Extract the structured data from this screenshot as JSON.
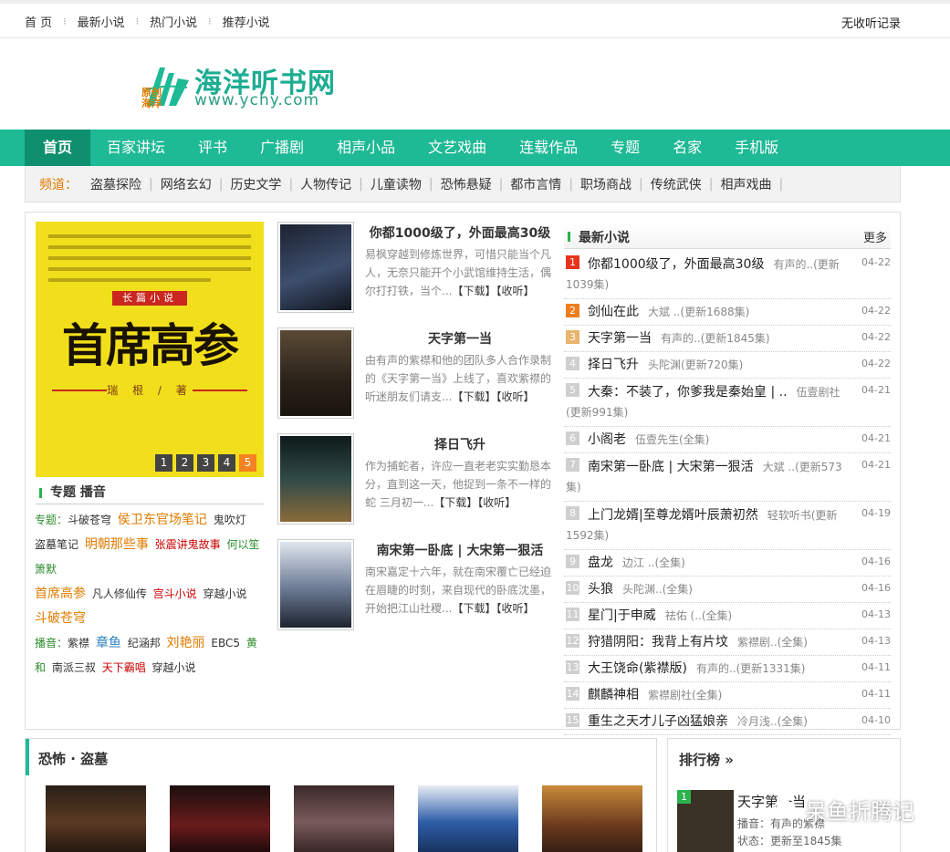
{
  "topbar": {
    "nav": [
      "首 页",
      "最新小说",
      "热门小说",
      "推荐小说"
    ],
    "history": "无收听记录"
  },
  "logo": {
    "name": "海洋听书网",
    "url": "www.ychy.com",
    "mark_text": "原创海洋"
  },
  "mainnav": [
    "首页",
    "百家讲坛",
    "评书",
    "广播剧",
    "相声小品",
    "文艺戏曲",
    "连载作品",
    "专题",
    "名家",
    "手机版"
  ],
  "channels": {
    "label": "频道：",
    "items": [
      "盗墓探险",
      "网络玄幻",
      "历史文学",
      "人物传记",
      "儿童读物",
      "恐怖悬疑",
      "都市言情",
      "职场商战",
      "传统武侠",
      "相声戏曲"
    ]
  },
  "slide": {
    "series": "长篇小说",
    "title": "首席高参",
    "author": "瑞 根 / 著",
    "pages": [
      "1",
      "2",
      "3",
      "4",
      "5"
    ],
    "active_page": "5"
  },
  "topics": {
    "heading": "专题 播音",
    "topic_label": "专题：",
    "topic_items": [
      "斗破苍穹",
      "侯卫东官场笔记",
      "鬼吹灯",
      "盗墓笔记",
      "明朝那些事",
      "张震讲鬼故事",
      "何以笙箫默",
      "首席高参",
      "凡人修仙传",
      "宫斗小说",
      "穿越小说",
      "斗破苍穹"
    ],
    "host_label": "播音：",
    "host_items": [
      "紫襟",
      "章鱼",
      "纪涵邦",
      "刘艳丽",
      "EBC5",
      "黄和",
      "南派三叔",
      "天下霸唱",
      "穿越小说"
    ]
  },
  "featured": [
    {
      "title": "你都1000级了，外面最高30级",
      "desc": "易枫穿越到修炼世界，可惜只能当个凡人，无奈只能开个小武馆维持生活，偶尔打打铁，当个...",
      "download": "【下载】",
      "fav": "【收听】"
    },
    {
      "title": "天字第一当",
      "desc": "由有声的紫襟和他的团队多人合作录制的《天字第一当》上线了，喜欢紫襟的听迷朋友们请支...",
      "download": "【下载】",
      "fav": "【收听】"
    },
    {
      "title": "择日飞升",
      "desc": "作为捕蛇者，许应一直老老实实勤恳本分，直到这一天，他捉到一条不一样的蛇 三月初一...",
      "download": "【下载】",
      "fav": "【收听】"
    },
    {
      "title": "南宋第一卧底 | 大宋第一狠活",
      "desc": "南宋嘉定十六年，就在南宋覆亡已经迫在眉睫的时刻，来自现代的卧底沈墨，开始把江山社稷...",
      "download": "【下载】",
      "fav": "【收听】"
    }
  ],
  "latest": {
    "heading": "最新小说",
    "more": "更多",
    "items": [
      {
        "rank": "1",
        "title": "你都1000级了，外面最高30级",
        "meta": "有声的..(更新1039集)",
        "date": "04-22"
      },
      {
        "rank": "2",
        "title": "剑仙在此",
        "meta": "大斌 ..(更新1688集)",
        "date": "04-22"
      },
      {
        "rank": "3",
        "title": "天字第一当",
        "meta": "有声的..(更新1845集)",
        "date": "04-22"
      },
      {
        "rank": "4",
        "title": "择日飞升",
        "meta": "头陀渊(更新720集)",
        "date": "04-22"
      },
      {
        "rank": "5",
        "title": "大秦：不装了，你爹我是秦始皇 | ..",
        "meta": "伍壹剧社(更新991集)",
        "date": "04-21"
      },
      {
        "rank": "6",
        "title": "小阁老",
        "meta": "伍壹先生(全集)",
        "date": "04-21"
      },
      {
        "rank": "7",
        "title": "南宋第一卧底 | 大宋第一狠活",
        "meta": "大斌 ..(更新573集)",
        "date": "04-21"
      },
      {
        "rank": "8",
        "title": "上门龙婿|至尊龙婿叶辰萧初然",
        "meta": "轻软听书(更新1592集)",
        "date": "04-19"
      },
      {
        "rank": "9",
        "title": "盘龙",
        "meta": "边江 ..(全集)",
        "date": "04-16"
      },
      {
        "rank": "10",
        "title": "头狼",
        "meta": "头陀渊..(全集)",
        "date": "04-16"
      },
      {
        "rank": "11",
        "title": "星门|于申威",
        "meta": "祛佑 (..(全集)",
        "date": "04-13"
      },
      {
        "rank": "12",
        "title": "狩猎阴阳：我背上有片坟",
        "meta": "紫襟剧..(全集)",
        "date": "04-13"
      },
      {
        "rank": "13",
        "title": "大王饶命(紫襟版)",
        "meta": "有声的..(更新1331集)",
        "date": "04-11"
      },
      {
        "rank": "14",
        "title": "麒麟神相",
        "meta": "紫襟剧社(全集)",
        "date": "04-11"
      },
      {
        "rank": "15",
        "title": "重生之天才儿子凶猛娘亲",
        "meta": "冷月浅..(全集)",
        "date": "04-10"
      }
    ]
  },
  "horror": {
    "heading": "恐怖 · 盗墓"
  },
  "ranking": {
    "heading": "排行榜 »",
    "rank": "1",
    "title": "天字第一当",
    "line1": "播音：有声的紫襟",
    "line2": "状态：更新至1845集"
  },
  "watermark": "呆鱼折腾记",
  "colors": {
    "brand_green": "#1eb995",
    "active_nav": "#0e8f6e",
    "accent_orange": "#f58220"
  }
}
